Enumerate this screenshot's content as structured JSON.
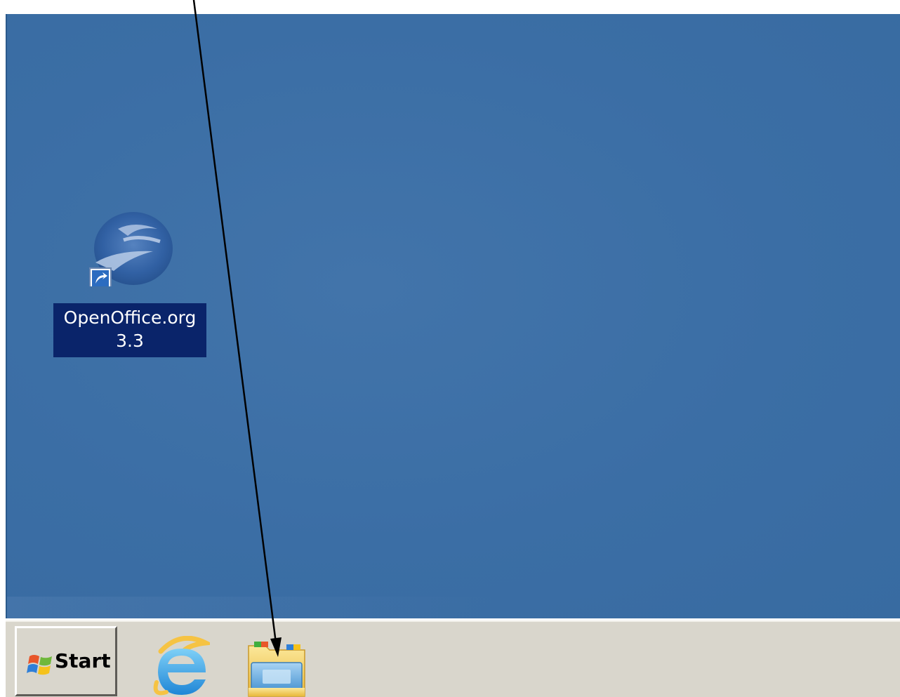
{
  "desktop": {
    "background_color": "#3b6ea5",
    "icons": [
      {
        "label": "OpenOffice.org\n3.3",
        "icon": "openoffice-icon",
        "selected": true,
        "selection_color": "#0a246a"
      }
    ]
  },
  "taskbar": {
    "background_color": "#d9d6cc",
    "start_button": {
      "label": "Start",
      "icon": "windows-flag-icon"
    },
    "quick_launch": [
      {
        "icon": "internet-explorer-icon"
      },
      {
        "icon": "windows-explorer-icon"
      }
    ]
  },
  "annotation": {
    "type": "arrow",
    "color": "#000000",
    "target": "windows-explorer-icon"
  }
}
